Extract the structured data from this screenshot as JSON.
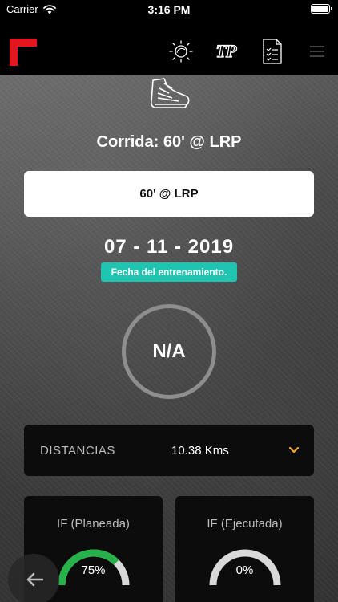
{
  "statusbar": {
    "carrier": "Carrier",
    "time": "3:16 PM"
  },
  "navbar": {
    "icons": [
      "logo-icon",
      "weather-sun-icon",
      "tp-icon",
      "checklist-icon",
      "menu-icon"
    ],
    "tp_label": "TP",
    "accent": "#e3161e"
  },
  "workout": {
    "title": "Corrida: 60' @ LRP",
    "name": "60' @ LRP",
    "date": "07 - 11 - 2019",
    "date_badge": "Fecha del entrenamiento.",
    "badge_color": "#1fc5b1",
    "score": "N/A"
  },
  "distance": {
    "label": "DISTANCIAS",
    "value": "10.38 Kms",
    "chevron_color": "#f5a623"
  },
  "intensity": [
    {
      "title": "IF (Planeada)",
      "value_label": "75%",
      "fraction": 0.75,
      "color": "#27b14a"
    },
    {
      "title": "IF (Ejecutada)",
      "value_label": "0%",
      "fraction": 0.0,
      "color": "#27b14a"
    }
  ]
}
